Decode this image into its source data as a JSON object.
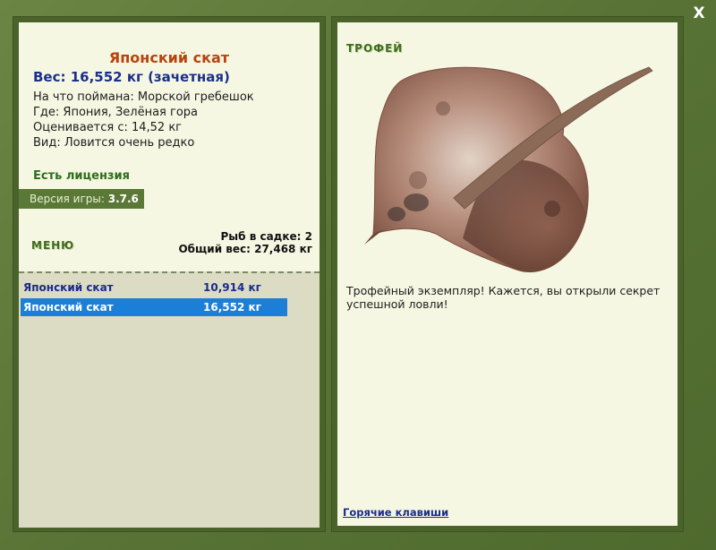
{
  "window": {
    "close_label": "X"
  },
  "fish": {
    "title": "Японский скат",
    "weight_line": "Вес: 16,552 кг (зачетная)",
    "caught_on": "На что поймана: Морской гребешок",
    "where": "Где: Япония, Зелёная гора",
    "valued_from": "Оценивается с: 14,52 кг",
    "rarity": "Вид: Ловится очень редко"
  },
  "license": "Есть лицензия",
  "version": {
    "label": "Версия игры:",
    "value": "3.7.6"
  },
  "menu_label": "МЕНЮ",
  "cage": {
    "count_line": "Рыб в садке: 2",
    "total_line": "Общий вес: 27,468 кг",
    "rows": [
      {
        "name": "Японский скат",
        "weight": "10,914 кг",
        "selected": false
      },
      {
        "name": "Японский скат",
        "weight": "16,552 кг",
        "selected": true
      }
    ]
  },
  "trophy": {
    "label": "ТРОФЕЙ",
    "text": "Трофейный экземпляр! Кажется, вы открыли секрет успешной ловли!",
    "hotkeys_label": "Горячие клавиши"
  },
  "colors": {
    "frame": "#5f7a3a",
    "panel": "#f6f7e3",
    "title": "#b8430e",
    "selection": "#1c7fd7"
  }
}
